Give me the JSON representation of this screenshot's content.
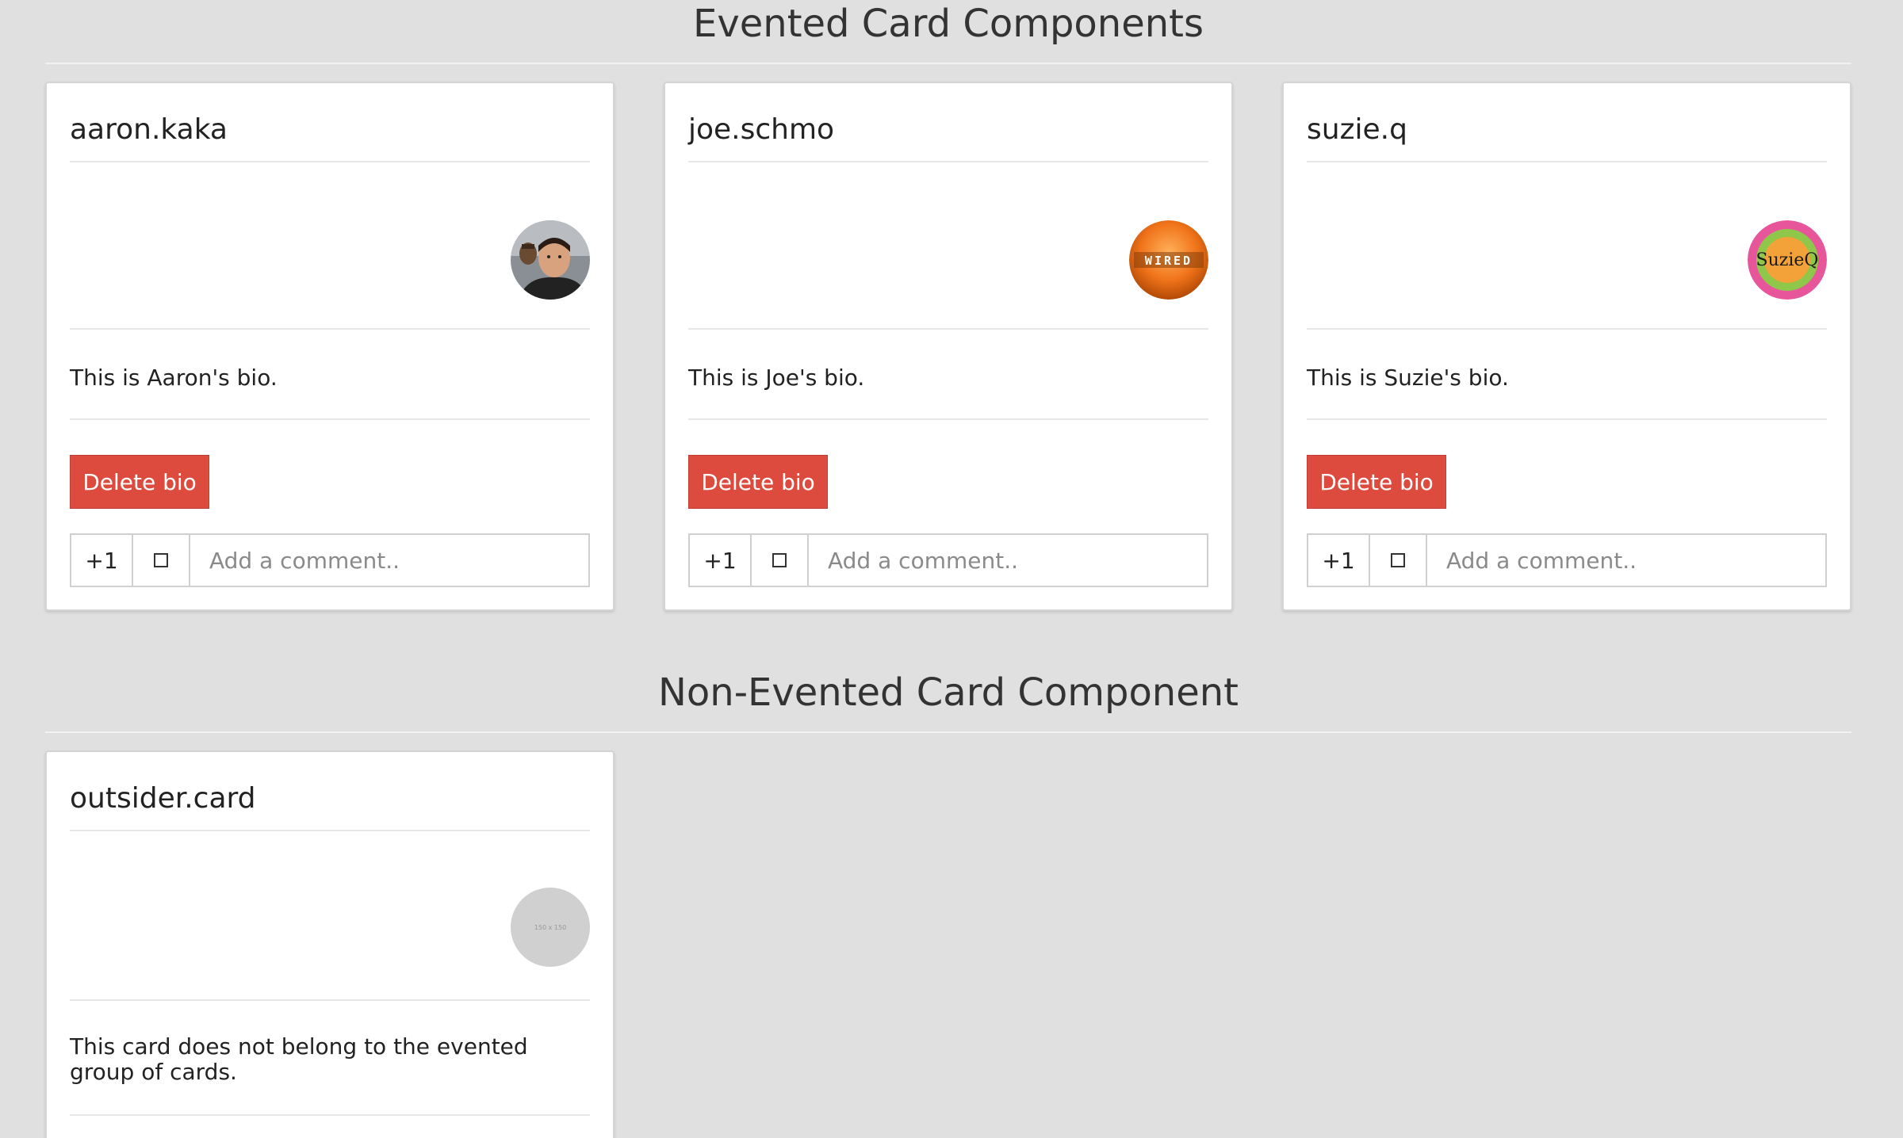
{
  "sections": {
    "evented_title": "Evented Card Components",
    "non_evented_title": "Non-Evented Card Component"
  },
  "cards": [
    {
      "username": "aaron.kaka",
      "avatar_icon": "user-photo-avatar",
      "bio": "This is Aaron's bio.",
      "delete_label": "Delete bio",
      "plus_label": "+1",
      "comment_placeholder": "Add a comment.."
    },
    {
      "username": "joe.schmo",
      "avatar_icon": "wired-logo-avatar",
      "avatar_text": "WIRED",
      "bio": "This is Joe's bio.",
      "delete_label": "Delete bio",
      "plus_label": "+1",
      "comment_placeholder": "Add a comment.."
    },
    {
      "username": "suzie.q",
      "avatar_icon": "suzieq-logo-avatar",
      "avatar_text": "SuzieQ",
      "bio": "This is Suzie's bio.",
      "delete_label": "Delete bio",
      "plus_label": "+1",
      "comment_placeholder": "Add a comment.."
    }
  ],
  "outsider_card": {
    "username": "outsider.card",
    "avatar_icon": "placeholder-avatar",
    "avatar_text": "150 x 150",
    "bio": "This card does not belong to the evented group of cards."
  },
  "colors": {
    "page_bg": "#e0e0e0",
    "card_bg": "#ffffff",
    "delete_button": "#dd4b3e",
    "placeholder_avatar": "#d0d0d0"
  }
}
